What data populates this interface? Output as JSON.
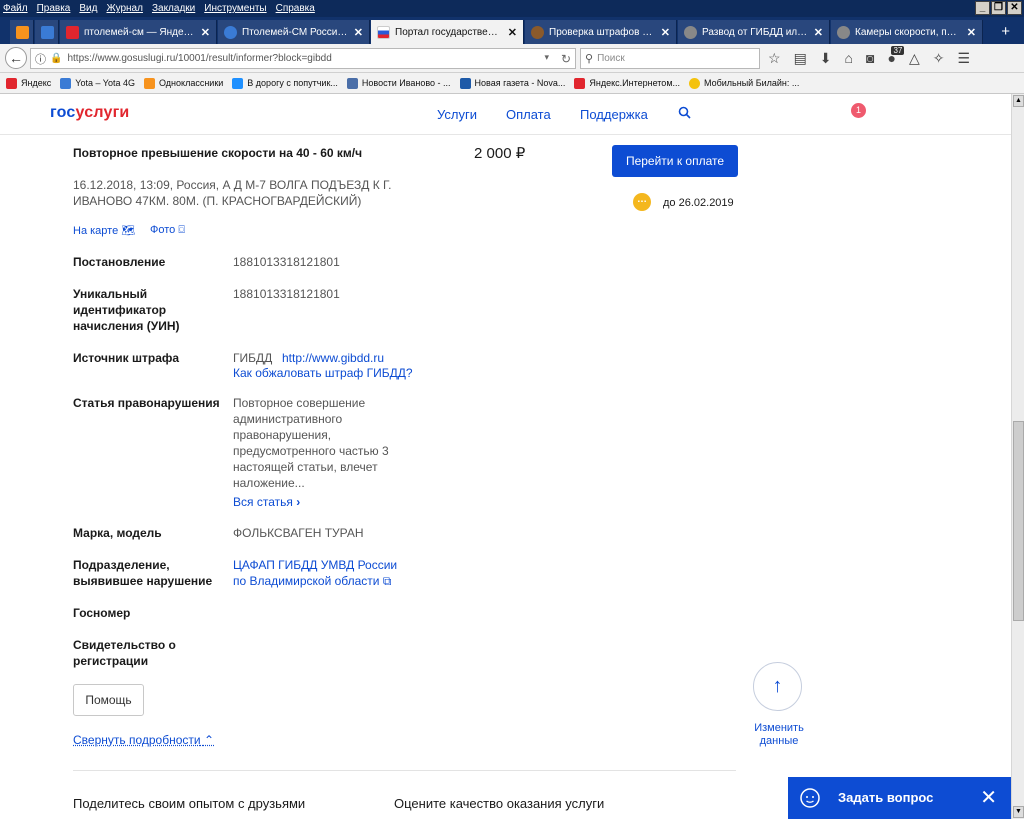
{
  "menu": [
    "Файл",
    "Правка",
    "Вид",
    "Журнал",
    "Закладки",
    "Инструменты",
    "Справка"
  ],
  "window_controls": [
    "_",
    "❐",
    "✕"
  ],
  "tabs": [
    {
      "title": "",
      "color": "#f7931e"
    },
    {
      "title": "",
      "color": "#3a7bd5"
    },
    {
      "title": "птолемей-см — Яндекс: ...",
      "color": "#e1262e"
    },
    {
      "title": "Птолемей-СМ Россия Вл...",
      "color": "#3a7bd5"
    },
    {
      "title": "Портал государственны...",
      "color": "#e1262e",
      "active": true
    },
    {
      "title": "Проверка штрафов ГИБ...",
      "color": "#8b5a2b"
    },
    {
      "title": "Развод от ГИБДД или п...",
      "color": "#888888"
    },
    {
      "title": "Камеры скорости, полос...",
      "color": "#888888"
    }
  ],
  "nav": {
    "url": "https://www.gosuslugi.ru/10001/result/informer?block=gibdd",
    "search_placeholder": "Поиск",
    "downloads_badge": "37"
  },
  "bookmarks": [
    {
      "label": "Яндекс",
      "color": "#e1262e"
    },
    {
      "label": "Yota – Yota 4G",
      "color": "#3a7bd5"
    },
    {
      "label": "Одноклассники",
      "color": "#f7931e"
    },
    {
      "label": "В дорогу с попутчик...",
      "color": "#1e90ff"
    },
    {
      "label": "Новости Иваново - ...",
      "color": "#4a6ea8"
    },
    {
      "label": "Новая газета - Nova...",
      "color": "#1e5aa8"
    },
    {
      "label": "Яндекс.Интернетом...",
      "color": "#e1262e"
    },
    {
      "label": "Мобильный Билайн: ...",
      "color": "#f4c20d"
    }
  ],
  "site": {
    "logo_part1": "гос",
    "logo_part2": "услуги",
    "nav": [
      "Услуги",
      "Оплата",
      "Поддержка"
    ],
    "notifications": "1"
  },
  "fine": {
    "title": "Повторное превышение скорости на 40 - 60 км/ч",
    "amount": "2 000 ₽",
    "pay_button": "Перейти к оплате",
    "due_prefix": "до",
    "due_date": "26.02.2019",
    "location_line1": "16.12.2018, 13:09, Россия, А Д М-7 ВОЛГА ПОДЪЕЗД К Г.",
    "location_line2": "ИВАНОВО 47КМ. 80М. (П. КРАСНОГВАРДЕЙСКИЙ)",
    "map_link": "На карте",
    "photo_link": "Фото"
  },
  "details": {
    "decree_label": "Постановление",
    "decree_value": "1881013318121801",
    "uin_label_1": "Уникальный",
    "uin_label_2": "идентификатор",
    "uin_label_3": "начисления (УИН)",
    "uin_value": "1881013318121801",
    "source_label": "Источник штрафа",
    "source_value": "ГИБДД",
    "source_link": "http://www.gibdd.ru",
    "appeal_link": "Как обжаловать штраф ГИБДД?",
    "article_label": "Статья правонарушения",
    "article_lines": [
      "Повторное совершение",
      "административного",
      "правонарушения,",
      "предусмотренного частью 3",
      "настоящей статьи, влечет",
      "наложение..."
    ],
    "article_link": "Вся статья",
    "car_label": "Марка, модель",
    "car_value": "ФОЛЬКСВАГЕН ТУРАН",
    "unit_label_1": "Подразделение,",
    "unit_label_2": "выявившее нарушение",
    "unit_value_1": "ЦАФАП ГИБДД УМВД России",
    "unit_value_2": "по Владимирской области",
    "plate_label": "Госномер",
    "cert_label_1": "Свидетельство о",
    "cert_label_2": "регистрации"
  },
  "actions": {
    "help": "Помощь",
    "collapse": "Свернуть подробности",
    "change_1": "Изменить",
    "change_2": "данные",
    "share": "Поделитесь своим опытом с друзьями",
    "rate": "Оцените качество оказания услуги",
    "chat": "Задать вопрос"
  }
}
